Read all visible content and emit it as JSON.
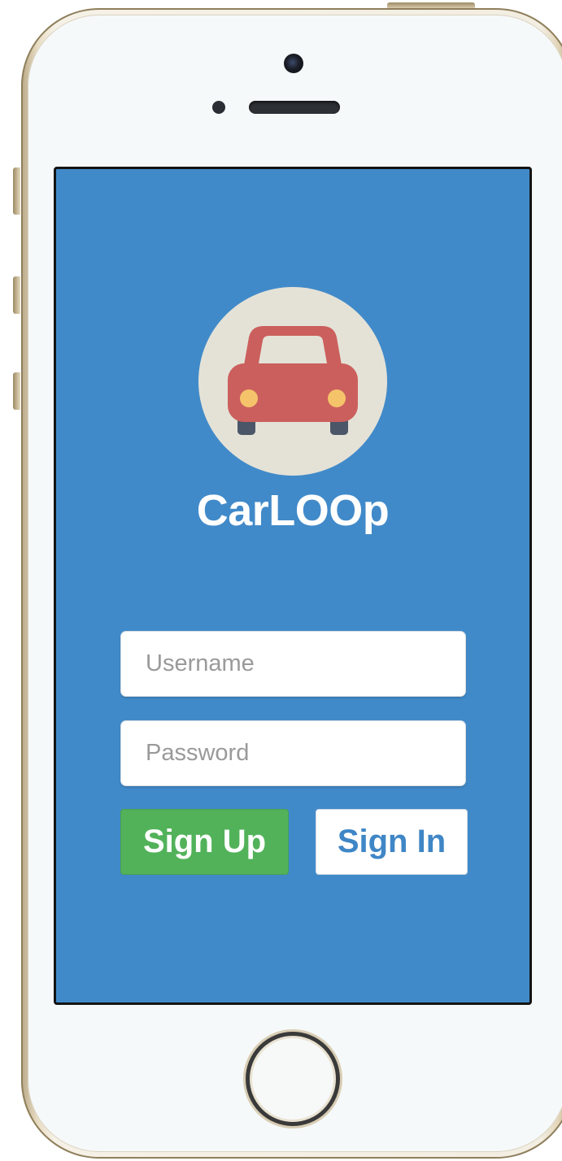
{
  "app": {
    "name": "CarLOOp",
    "logo_icon": "car-icon"
  },
  "login_form": {
    "username_placeholder": "Username",
    "password_placeholder": "Password",
    "signup_label": "Sign Up",
    "signin_label": "Sign In"
  },
  "colors": {
    "screen_background": "#418ac9",
    "signup_button": "#52b25a",
    "signin_text": "#3f86c6",
    "logo_circle": "#e4e2d7",
    "car_body": "#cb5f5d",
    "headlights": "#f5c46a"
  },
  "device": {
    "frame": "iphone-gold-mockup"
  }
}
